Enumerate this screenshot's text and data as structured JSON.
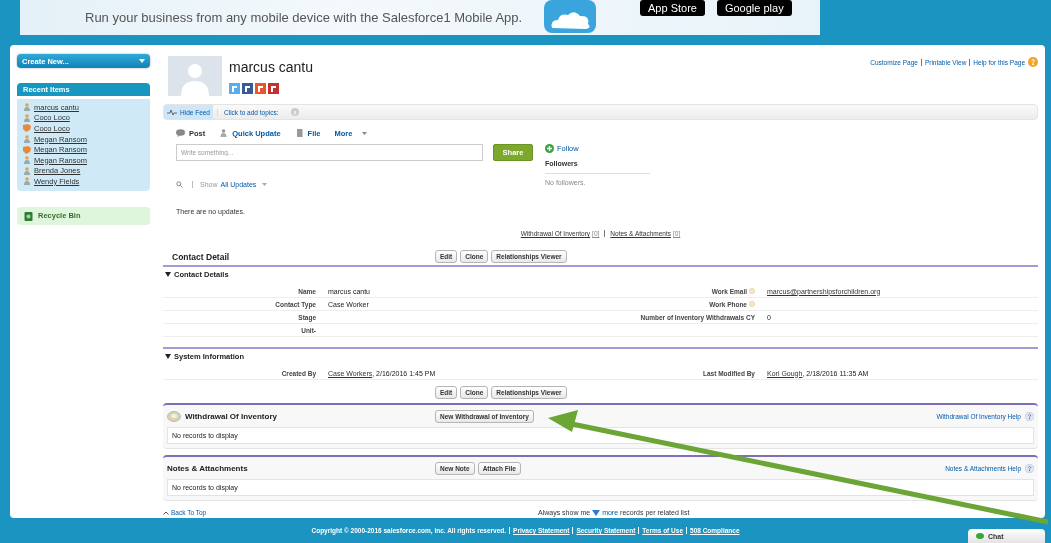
{
  "banner": {
    "text": "Run your business from any mobile device with the Salesforce1 Mobile App.",
    "badges": [
      "App Store",
      "Google play"
    ]
  },
  "sidebar": {
    "create_button": "Create New...",
    "recent_title": "Recent Items",
    "recent_items": [
      {
        "label": "marcus cantu",
        "kind": "contact"
      },
      {
        "label": "Coco Loco",
        "kind": "contact"
      },
      {
        "label": "Coco Loco",
        "kind": "account"
      },
      {
        "label": "Megan Ransom",
        "kind": "contact"
      },
      {
        "label": "Megan Ransom",
        "kind": "account"
      },
      {
        "label": "Megan Ransom",
        "kind": "contact"
      },
      {
        "label": "Brenda Jones",
        "kind": "contact"
      },
      {
        "label": "Wendy Fields",
        "kind": "contact"
      }
    ],
    "recycle_bin": "Recycle Bin"
  },
  "profile": {
    "name": "marcus cantu"
  },
  "page_links": [
    "Customize Page",
    "Printable View",
    "Help for this Page"
  ],
  "feed_bar": {
    "hide_feed": "Hide Feed",
    "topics": "Click to add topics:"
  },
  "publisher": {
    "tabs": [
      {
        "label": "Post",
        "selected": true
      },
      {
        "label": "Quick Update",
        "selected": false
      },
      {
        "label": "File",
        "selected": false
      },
      {
        "label": "More",
        "selected": false
      }
    ],
    "placeholder": "Write something...",
    "share": "Share"
  },
  "followers": {
    "follow": "Follow",
    "title": "Followers",
    "empty": "No followers."
  },
  "feed_filter": {
    "show": "Show",
    "value": "All Updates"
  },
  "feed_empty": "There are no updates.",
  "related_links": [
    {
      "label": "Withdrawal Of Inventory",
      "count": "[0]"
    },
    {
      "label": "Notes & Attachments",
      "count": "[0]"
    }
  ],
  "detail": {
    "title": "Contact Detail",
    "buttons": [
      "Edit",
      "Clone",
      "Relationships Viewer"
    ],
    "sections": [
      {
        "title": "Contact Details",
        "expanded": true,
        "rows": [
          {
            "left_label": "Name",
            "left_value": {
              "text": "marcus cantu"
            },
            "right_label": "Work Email",
            "right_help": true,
            "right_value": {
              "link": "marcus@partnershipsforchildren.org"
            }
          },
          {
            "left_label": "Contact Type",
            "left_value": {
              "text": "Case Worker"
            },
            "right_label": "Work Phone",
            "right_help": true
          },
          {
            "left_label": "Stage",
            "right_label": "Number of Inventory Withdrawals CY",
            "right_help": false,
            "right_value": {
              "text": "0"
            }
          },
          {
            "left_label": "Unit-",
            "right_help": false
          }
        ]
      },
      {
        "title": "System Information",
        "expanded": true,
        "rows": [
          {
            "left_label": "Created By",
            "left_value": {
              "link": "Case Workers",
              "text": ", 2/16/2016 1:45 PM"
            },
            "right_label": "Last Modified By",
            "right_help": false,
            "right_value": {
              "link": "Kori Gough",
              "text": ", 2/18/2016 11:35 AM"
            }
          }
        ]
      }
    ],
    "bottom_buttons": [
      "Edit",
      "Clone",
      "Relationships Viewer"
    ]
  },
  "related_lists": [
    {
      "title": "Withdrawal Of Inventory",
      "kind": "custom",
      "buttons": [
        "New Withdrawal of Inventory"
      ],
      "help": "Withdrawal Of Inventory Help",
      "empty": "No records to display"
    },
    {
      "title": "Notes & Attachments",
      "kind": "standard",
      "buttons": [
        "New Note",
        "Attach File"
      ],
      "help": "Notes & Attachments Help",
      "empty": "No records to display"
    }
  ],
  "list_footer": {
    "back_to_top": "Back To Top",
    "before": "Always show me",
    "more": "more",
    "after": "records per related list"
  },
  "copyright": {
    "text": "Copyright © 2000-2016 salesforce.com, inc. All rights reserved.",
    "links": [
      "Privacy Statement",
      "Security Statement",
      "Terms of Use",
      "508 Compliance"
    ]
  },
  "chat": "Chat"
}
